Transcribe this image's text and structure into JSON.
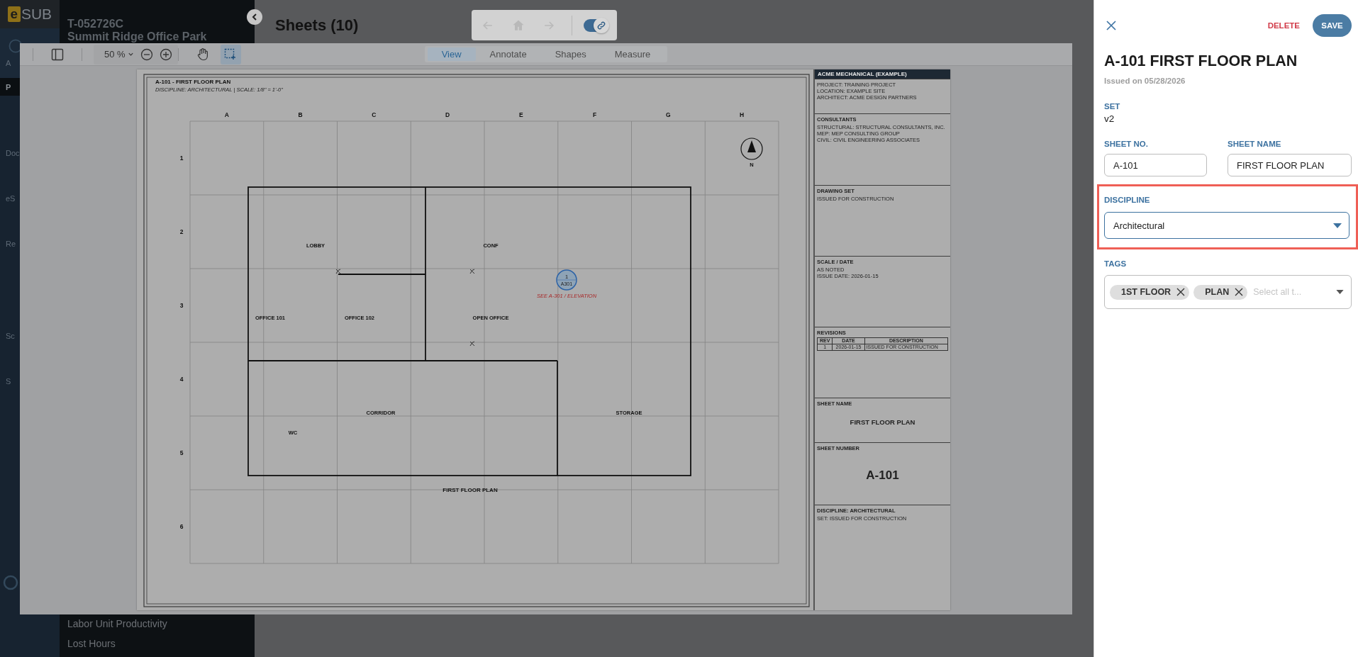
{
  "app": {
    "logo": {
      "mark": "e",
      "text": "SUB"
    },
    "rail": [
      {
        "label": "A",
        "selected": false
      },
      {
        "label": "P",
        "selected": true
      },
      {
        "label": "Doc",
        "selected": false
      },
      {
        "label": "eS",
        "selected": false
      },
      {
        "label": "Re",
        "selected": false
      },
      {
        "label": "Sc",
        "selected": false
      },
      {
        "label": "S",
        "selected": false
      }
    ],
    "project": {
      "code": "T-052726C",
      "name": "Summit Ridge Office Park"
    },
    "sidebar_items": [
      "Labor Unit Productivity",
      "Lost Hours"
    ],
    "page_title": "Sheets (10)",
    "history_nav": [
      {
        "kind": "back",
        "disabled": true
      },
      {
        "kind": "home",
        "disabled": true
      },
      {
        "kind": "forward",
        "disabled": true
      }
    ],
    "link_toggle": {
      "on": true
    }
  },
  "viewer": {
    "zoom": "50 %",
    "tools": [
      {
        "kind": "pan",
        "selected": false
      },
      {
        "kind": "select",
        "selected": true
      }
    ],
    "tabs": [
      {
        "label": "View",
        "selected": true
      },
      {
        "label": "Annotate",
        "selected": false
      },
      {
        "label": "Shapes",
        "selected": false
      },
      {
        "label": "Measure",
        "selected": false
      }
    ]
  },
  "sheet": {
    "title": "A-101  -  FIRST FLOOR PLAN",
    "subtitle": "DISCIPLINE: ARCHITECTURAL  |  SCALE: 1/8\" = 1'-0\"",
    "columns": [
      "A",
      "B",
      "C",
      "D",
      "E",
      "F",
      "G",
      "H"
    ],
    "rows": [
      "1",
      "2",
      "3",
      "4",
      "5",
      "6"
    ],
    "rooms": [
      "LOBBY",
      "CONF",
      "OFFICE 101",
      "OFFICE 102",
      "OPEN OFFICE",
      "CORRIDOR",
      "STORAGE",
      "WC"
    ],
    "caption": "FIRST FLOOR PLAN",
    "callout": {
      "number": "1",
      "sheet": "A301",
      "note": "SEE A-301 / ELEVATION"
    },
    "north": "N",
    "title_block": {
      "company": "ACME MECHANICAL (EXAMPLE)",
      "sections": [
        {
          "kind": "lines",
          "lines": [
            "PROJECT: TRAINING PROJECT",
            "LOCATION: EXAMPLE SITE",
            "ARCHITECT: ACME DESIGN PARTNERS"
          ]
        },
        {
          "kind": "lines",
          "heading": "CONSULTANTS",
          "lines": [
            "STRUCTURAL: STRUCTURAL CONSULTANTS, INC.",
            "MEP: MEP CONSULTING GROUP",
            "CIVIL: CIVIL ENGINEERING ASSOCIATES"
          ]
        },
        {
          "kind": "lines",
          "heading": "DRAWING SET",
          "lines": [
            "ISSUED FOR CONSTRUCTION"
          ]
        },
        {
          "kind": "lines",
          "heading": "SCALE / DATE",
          "lines": [
            "AS NOTED",
            "ISSUE DATE: 2026-01-15"
          ]
        },
        {
          "kind": "table",
          "heading": "REVISIONS",
          "columns": [
            "REV",
            "DATE",
            "DESCRIPTION"
          ],
          "rows": [
            [
              "1",
              "2026-01-15",
              "ISSUED FOR CONSTRUCTION"
            ]
          ]
        },
        {
          "kind": "name",
          "heading": "SHEET NAME",
          "value": "FIRST FLOOR PLAN"
        },
        {
          "kind": "number",
          "heading": "SHEET NUMBER",
          "value": "A-101"
        },
        {
          "kind": "lines",
          "heading": "DISCIPLINE: ARCHITECTURAL",
          "lines": [
            "SET: ISSUED FOR CONSTRUCTION"
          ]
        }
      ]
    }
  },
  "panel": {
    "delete": "DELETE",
    "save": "SAVE",
    "title": "**A-101** FIRST FLOOR PLAN",
    "issued": "Issued on 05/28/2026",
    "set": {
      "label": "SET",
      "value": "v2"
    },
    "sheet_no": {
      "label": "SHEET NO.",
      "value": "A-101"
    },
    "sheet_name": {
      "label": "SHEET NAME",
      "value": "FIRST FLOOR PLAN"
    },
    "discipline": {
      "label": "DISCIPLINE",
      "value": "Architectural",
      "highlighted": true
    },
    "tags": {
      "label": "TAGS",
      "chips": [
        "1ST FLOOR",
        "PLAN"
      ],
      "placeholder": "Select all t..."
    }
  }
}
